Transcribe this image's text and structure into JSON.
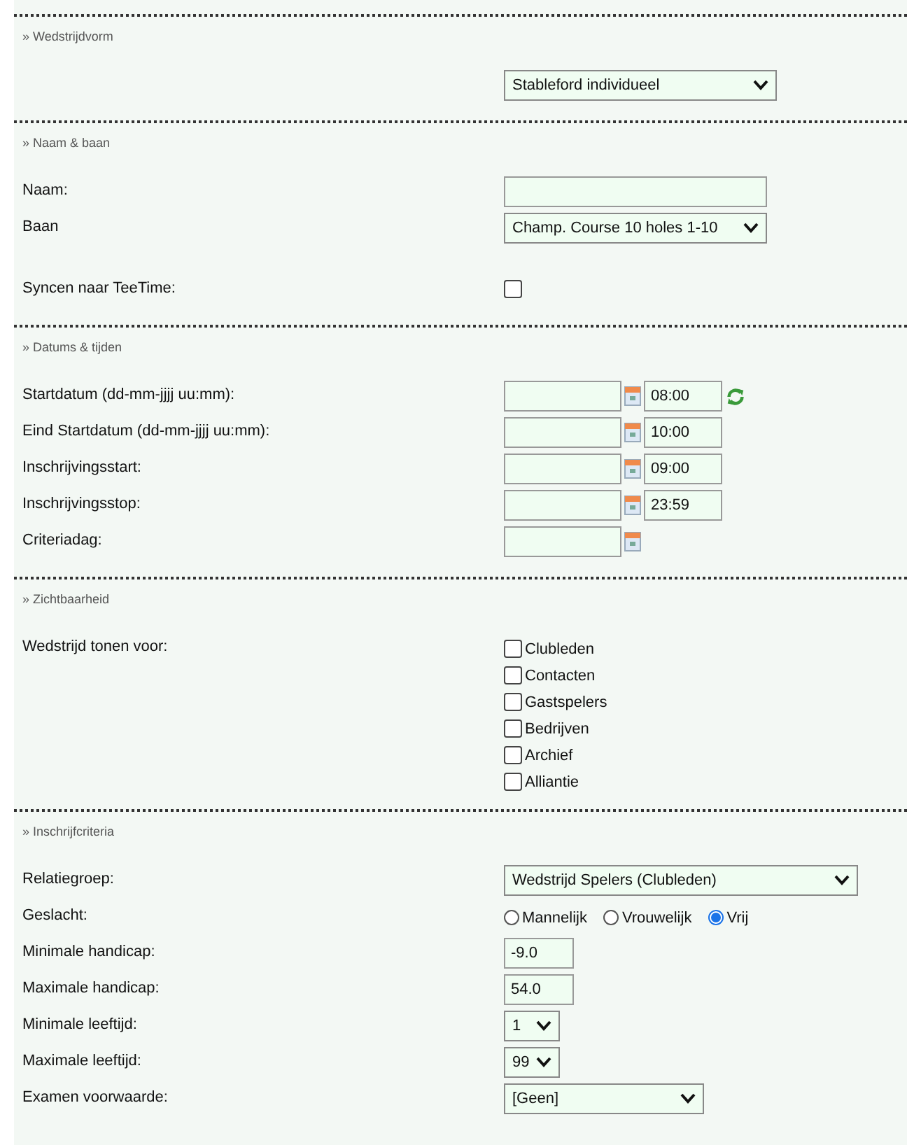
{
  "sections": [
    {
      "title": "» Wedstrijdvorm",
      "rows": [
        {
          "kind": "select",
          "label": "",
          "value": "Stableford individueel"
        }
      ]
    },
    {
      "title": "» Naam & baan",
      "rows": [
        {
          "kind": "text",
          "label": "Naam:",
          "value": ""
        },
        {
          "kind": "select",
          "label": "Baan",
          "value": "Champ. Course 10 holes 1-10"
        },
        {
          "kind": "checkbox",
          "label": "Syncen naar TeeTime:",
          "checked": false
        }
      ]
    },
    {
      "title": "» Datums & tijden",
      "rows": [
        {
          "kind": "datetime",
          "label": "Startdatum (dd-mm-jjjj uu:mm):",
          "date": "",
          "time": "08:00",
          "refresh": true
        },
        {
          "kind": "datetime",
          "label": "Eind Startdatum (dd-mm-jjjj uu:mm):",
          "date": "",
          "time": "10:00",
          "refresh": false
        },
        {
          "kind": "datetime",
          "label": "Inschrijvingsstart:",
          "date": "",
          "time": "09:00",
          "refresh": false
        },
        {
          "kind": "datetime",
          "label": "Inschrijvingsstop:",
          "date": "",
          "time": "23:59",
          "refresh": false
        },
        {
          "kind": "date",
          "label": "Criteriadag:",
          "date": ""
        }
      ]
    },
    {
      "title": "» Zichtbaarheid",
      "rows": [
        {
          "kind": "checklist",
          "label": "Wedstrijd tonen voor:",
          "options": [
            {
              "label": "Clubleden",
              "checked": false
            },
            {
              "label": "Contacten",
              "checked": false
            },
            {
              "label": "Gastspelers",
              "checked": false
            },
            {
              "label": "Bedrijven",
              "checked": false
            },
            {
              "label": "Archief",
              "checked": false
            },
            {
              "label": "Alliantie",
              "checked": false
            }
          ]
        }
      ]
    },
    {
      "title": "» Inschrijfcriteria",
      "rows": [
        {
          "kind": "select",
          "label": "Relatiegroep:",
          "value": "Wedstrijd Spelers (Clubleden)"
        },
        {
          "kind": "radio",
          "label": "Geslacht:",
          "options": [
            {
              "label": "Mannelijk",
              "selected": false
            },
            {
              "label": "Vrouwelijk",
              "selected": false
            },
            {
              "label": "Vrij",
              "selected": true
            }
          ]
        },
        {
          "kind": "number",
          "label": "Minimale handicap:",
          "value": "-9.0"
        },
        {
          "kind": "number",
          "label": "Maximale handicap:",
          "value": "54.0"
        },
        {
          "kind": "small-select",
          "label": "Minimale leeftijd:",
          "value": "1"
        },
        {
          "kind": "small-select",
          "label": "Maximale leeftijd:",
          "value": "99"
        },
        {
          "kind": "select",
          "label": "Examen voorwaarde:",
          "value": "[Geen]"
        }
      ]
    }
  ]
}
